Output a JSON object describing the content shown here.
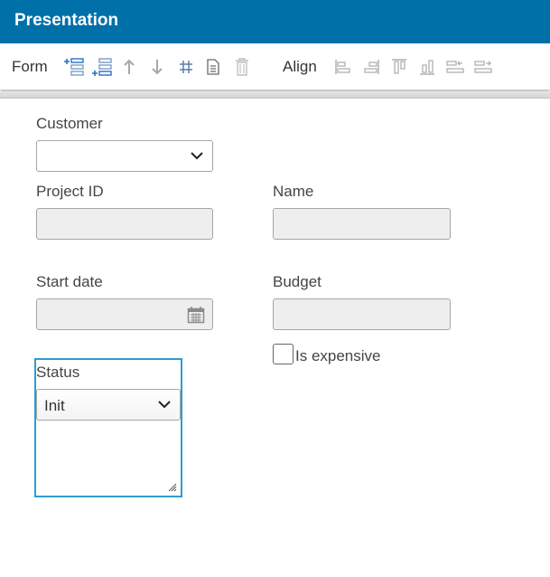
{
  "window": {
    "title": "Presentation"
  },
  "toolbar": {
    "form_label": "Form",
    "align_label": "Align",
    "form_buttons": [
      "add-row-above-icon",
      "add-row-below-icon",
      "arrow-up-icon",
      "arrow-down-icon",
      "grid-icon",
      "document-icon",
      "trash-icon"
    ],
    "align_buttons": [
      "align-left-icon",
      "align-right-icon",
      "align-top-icon",
      "align-bottom-icon",
      "distribute-left-icon",
      "distribute-right-icon"
    ]
  },
  "form": {
    "customer": {
      "label": "Customer",
      "value": ""
    },
    "project_id": {
      "label": "Project ID",
      "value": ""
    },
    "name": {
      "label": "Name",
      "value": ""
    },
    "start_date": {
      "label": "Start date",
      "value": ""
    },
    "budget": {
      "label": "Budget",
      "value": ""
    },
    "is_expensive": {
      "label": "Is expensive",
      "checked": false
    },
    "status": {
      "label": "Status",
      "value": "Init"
    }
  },
  "colors": {
    "accent": "#0070a9",
    "selection": "#2f9bd1",
    "icon": "#4a7ab8"
  }
}
